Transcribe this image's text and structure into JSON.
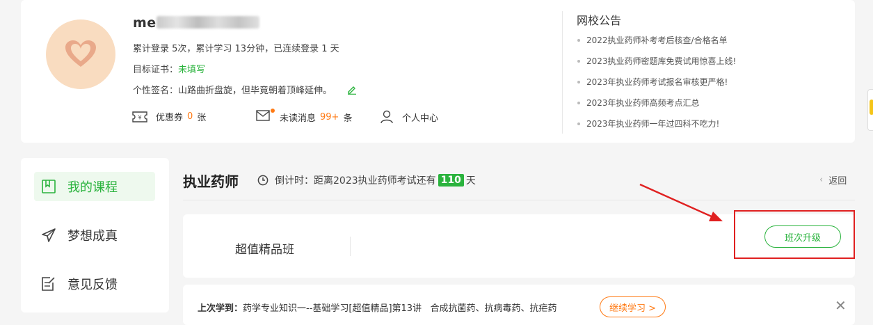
{
  "profile": {
    "username_prefix": "me",
    "username_blurred": "dwangxiao0572",
    "stats": "累计登录 5次，累计学习 13分钟，已连续登录 1 天",
    "cert_label": "目标证书：",
    "cert_value": "未填写",
    "sign_label": "个性签名：",
    "sign_value": "山路曲折盘旋，但毕竟朝着顶峰延伸。",
    "coupon_label": "优惠券",
    "coupon_count": "0",
    "coupon_unit": "张",
    "msg_label": "未读消息",
    "msg_count": "99+",
    "msg_unit": "条",
    "center_label": "个人中心"
  },
  "notice": {
    "title": "网校公告",
    "items": [
      "2022执业药师补考考后核查/合格名单",
      "2023执业药师密题库免费试用惊喜上线!",
      "2023年执业药师考试报名审核更严格!",
      "2023年执业药师高频考点汇总",
      "2023年执业药师一年过四科不吃力!"
    ]
  },
  "sidebar": {
    "items": [
      {
        "label": "我的课程",
        "icon": "book-icon"
      },
      {
        "label": "梦想成真",
        "icon": "paper-plane-icon"
      },
      {
        "label": "意见反馈",
        "icon": "feedback-icon"
      }
    ]
  },
  "course": {
    "title": "执业药师",
    "countdown_prefix": "倒计时：距离2023执业药师考试还有",
    "countdown_days": "110",
    "countdown_suffix": "天",
    "back_label": "返回",
    "class_name": "超值精品班",
    "upgrade_label": "班次升级"
  },
  "last_study": {
    "label": "上次学到：",
    "text": "药学专业知识一--基础学习[超值精品]第13讲   合成抗菌药、抗病毒药、抗疟药",
    "continue_label": "继续学习 >"
  },
  "colors": {
    "accent": "#2ab33d",
    "orange": "#ff7a14",
    "highlight": "#e02020"
  }
}
